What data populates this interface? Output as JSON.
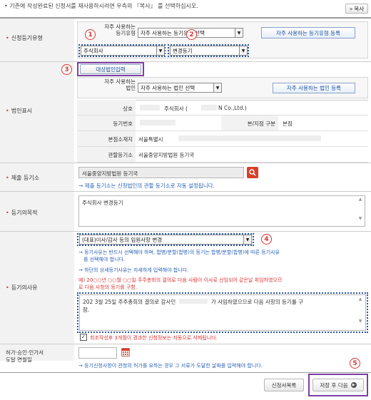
{
  "top_note": "• 기존에 작성완료된 신청서를 재사용하시려면 우측의 『복사』 를 선택하십시오.",
  "copy_button": "복사",
  "copy_prefix": "»",
  "sections": {
    "reg_type": {
      "label": "신청등기유형",
      "freq_label_line1": "자주 사용하는",
      "freq_label_line2": "등기유형",
      "freq_select_value": "자주 사용하는 등기유형 선택",
      "freq_register_button": "자주 사용하는 등기유형 등록",
      "corp_kind_value": "주식회사",
      "reg_kind_value": "변경등기"
    },
    "corp_display": {
      "label": "법인표시",
      "target_button": "대상법인입력",
      "freq_label_line1": "자주 사용하는",
      "freq_label_line2": "법인",
      "freq_select_value": "자주 사용하는 법인 선택",
      "freq_register_button": "자주 사용하는 법인 등록",
      "rows": {
        "trade_name_label": "상호",
        "trade_name_value": "주식회사 (",
        "trade_name_value2": "N Co.,Ltd.)",
        "reg_no_label": "등기번호",
        "branch_label": "본/지점 구분",
        "branch_value": "본점",
        "address_label": "본점소재지",
        "address_value": "서울특별시",
        "office_label": "관할등기소",
        "office_value": "서울중앙지방법원 등기국"
      }
    },
    "submit_office": {
      "label": "제출 등기소",
      "value": "서울중앙지방법원 등기국",
      "note": "→ 제출 등기소는 신청법인의 관할 등기소로 자동 설정됩니다."
    },
    "purpose": {
      "label": "등기의목적",
      "value": "주식회사 변경등기"
    },
    "reason": {
      "label": "등기의사유",
      "select_value": "(대표)이사/감사 등의 임원사항 변경",
      "note1": "→ 등기사유는 반드시 선택해야 하며, 합병/분할(합병)의 등기는 합병/분할(합병)에 따른 등기사유",
      "note1b": "를 선택해야 합니다.",
      "note2": "→ 하단의 상세등기사유는 자세하게 입력해야 합니다.",
      "example1": "예) 20○○년 ○○월 ○○일 주주총회의 결의로 다음 사람이 이사로 선임되어 같은날 취임하였으므",
      "example2": "로 다음 사항의 등기를 구함.",
      "text_line1": "202   3월 25일 주주총회의 결의로 감사인",
      "text_line1b": "가 사임하였으므로 다음 사항의 등기를 구",
      "text_line2": "함.",
      "auto_delete_note": "최조작성후 3개월이 경과한 신청정보는 자동으로 삭제됩니다."
    },
    "permit": {
      "label_line1": "허가·승인·인가서",
      "label_line2": "도달 연월일",
      "note": "→ 등기신청사항이 관청의 허가를 요하는 경우 그 서류가 도달한 날짜를 입력해야 합니다."
    }
  },
  "footer": {
    "list_button": "신청서목록",
    "save_next_button": "저장 후 다음"
  },
  "callouts": [
    "1",
    "2",
    "3",
    "4",
    "5"
  ],
  "colors": {
    "accent_blue": "#2a62b8",
    "callout_red": "#dd3333",
    "highlight_purple": "#7d3fa4",
    "search_button": "#d9402b"
  }
}
